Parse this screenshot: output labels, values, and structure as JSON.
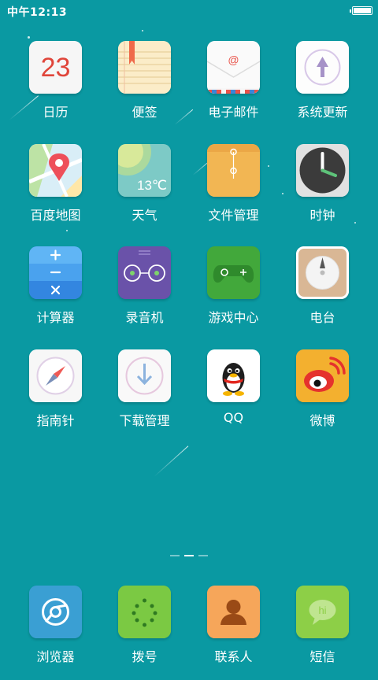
{
  "status": {
    "time": "中午12:13"
  },
  "apps": {
    "calendar": {
      "label": "日历",
      "date": "23"
    },
    "notes": {
      "label": "便签"
    },
    "email": {
      "label": "电子邮件"
    },
    "update": {
      "label": "系统更新"
    },
    "maps": {
      "label": "百度地图"
    },
    "weather": {
      "label": "天气",
      "temp": "13℃"
    },
    "files": {
      "label": "文件管理"
    },
    "clock": {
      "label": "时钟"
    },
    "calculator": {
      "label": "计算器"
    },
    "recorder": {
      "label": "录音机"
    },
    "games": {
      "label": "游戏中心"
    },
    "radio": {
      "label": "电台"
    },
    "compass": {
      "label": "指南针"
    },
    "downloads": {
      "label": "下载管理"
    },
    "qq": {
      "label": "QQ"
    },
    "weibo": {
      "label": "微博"
    }
  },
  "dock": {
    "browser": {
      "label": "浏览器"
    },
    "dialer": {
      "label": "拨号"
    },
    "contacts": {
      "label": "联系人"
    },
    "messages": {
      "label": "短信",
      "bubble": "hi"
    }
  },
  "pager": {
    "pages": 3,
    "current": 2
  },
  "colors": {
    "wallpaper": "#0a99a2"
  }
}
